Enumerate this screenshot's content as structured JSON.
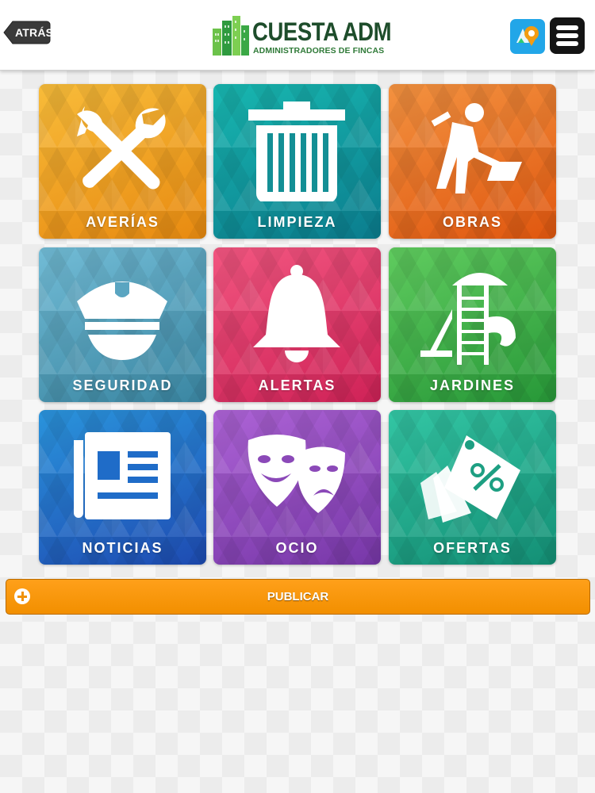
{
  "header": {
    "back_label": "ATRÁS",
    "brand": "CUESTA ADM",
    "tagline": "ADMINISTRADORES DE FINCAS"
  },
  "tiles": [
    {
      "label": "AVERÍAS",
      "icon": "tools-icon",
      "color_from": "#f7b733",
      "color_to": "#e98b12"
    },
    {
      "label": "LIMPIEZA",
      "icon": "trash-icon",
      "color_from": "#16b3ac",
      "color_to": "#0d7f8f"
    },
    {
      "label": "OBRAS",
      "icon": "construction-worker-icon",
      "color_from": "#f08a3a",
      "color_to": "#e05a12"
    },
    {
      "label": "SEGURIDAD",
      "icon": "police-cap-icon",
      "color_from": "#6ab6d0",
      "color_to": "#3d8aa7"
    },
    {
      "label": "ALERTAS",
      "icon": "bell-icon",
      "color_from": "#f0517a",
      "color_to": "#d0245a"
    },
    {
      "label": "JARDINES",
      "icon": "playground-icon",
      "color_from": "#5bc85c",
      "color_to": "#2a9a3a"
    },
    {
      "label": "NOTICIAS",
      "icon": "newspaper-icon",
      "color_from": "#2a8fd8",
      "color_to": "#1f4fb5"
    },
    {
      "label": "OCIO",
      "icon": "theater-masks-icon",
      "color_from": "#a35ad0",
      "color_to": "#7a3aaa"
    },
    {
      "label": "OFERTAS",
      "icon": "price-tag-icon",
      "color_from": "#2ec2a0",
      "color_to": "#16957a"
    }
  ],
  "publish": {
    "label": "PUBLICAR",
    "color": "#f7960f"
  }
}
